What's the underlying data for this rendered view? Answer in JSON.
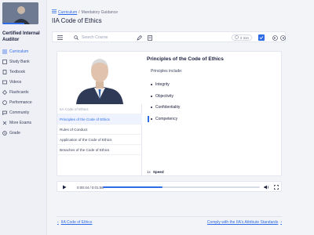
{
  "sidebar": {
    "course_title": "Certified Internal Auditor",
    "progress_fraction": 0.6,
    "items": [
      {
        "label": "Curriculum",
        "icon": "list-icon",
        "active": true
      },
      {
        "label": "Study Bank",
        "icon": "layers-icon"
      },
      {
        "label": "Textbook",
        "icon": "book-icon"
      },
      {
        "label": "Videos",
        "icon": "video-icon"
      },
      {
        "label": "Flashcards",
        "icon": "flashcard-icon"
      },
      {
        "label": "Performance",
        "icon": "chart-icon"
      },
      {
        "label": "Community",
        "icon": "chat-icon"
      },
      {
        "label": "More Exams",
        "icon": "exam-icon"
      },
      {
        "label": "Grade",
        "icon": "grade-icon"
      }
    ]
  },
  "breadcrumb": {
    "link": "Curriculum",
    "separator": "/",
    "current": "Mandatory Guidance"
  },
  "page_title": "IIA Code of Ethics",
  "toolbar": {
    "search_placeholder": "Search Course",
    "time_label": "2 min"
  },
  "outline": {
    "header": "IIA Code of Ethics",
    "items": [
      {
        "label": "Principles of the Code of Ethics",
        "active": true
      },
      {
        "label": "Rules of Conduct"
      },
      {
        "label": "Application of the Code of Ethics"
      },
      {
        "label": "Breaches of the Code of Ethics"
      }
    ]
  },
  "slide": {
    "title": "Principles of the Code of Ethics",
    "intro": "Principles include:",
    "bullets": [
      "Integrity",
      "Objectivity",
      "Confidentiality",
      "Competency"
    ]
  },
  "speed": {
    "value": "1x",
    "label": "Speed"
  },
  "player": {
    "current": "0:00:44",
    "separator": "/",
    "duration": "0:01:56",
    "progress_fraction": 0.38
  },
  "footer": {
    "prev_label": "IIA Code of Ethics",
    "next_label": "Comply with the IIA's Attribute Standards"
  },
  "colors": {
    "accent": "#2e6be6",
    "sidebar_bg": "#eef0f6",
    "page_bg": "#f3f4f7"
  }
}
